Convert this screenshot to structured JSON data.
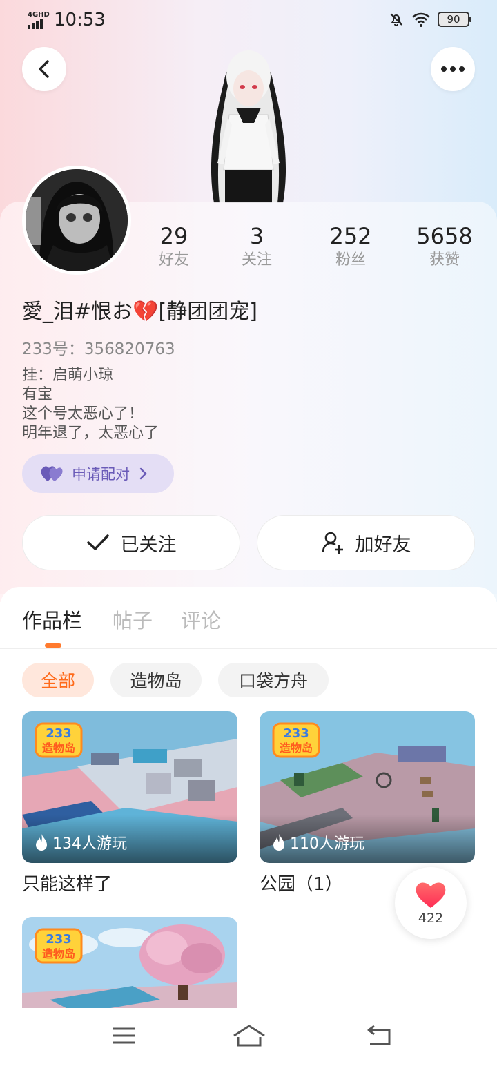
{
  "status_bar": {
    "network": "4GHD",
    "time": "10:53",
    "battery": "90"
  },
  "profile": {
    "stats": [
      {
        "num": "29",
        "label": "好友"
      },
      {
        "num": "3",
        "label": "关注"
      },
      {
        "num": "252",
        "label": "粉丝"
      },
      {
        "num": "5658",
        "label": "获赞"
      }
    ],
    "username": "愛_泪#恨お💔[静团团宠]",
    "user_id": "233号：356820763",
    "bio": [
      "挂：启萌小琼",
      "有宝",
      "这个号太恶心了！",
      "明年退了，太恶心了"
    ],
    "pair_label": "申请配对",
    "follow_label": "已关注",
    "add_friend_label": "加好友"
  },
  "tabs": [
    "作品栏",
    "帖子",
    "评论"
  ],
  "filters": [
    "全部",
    "造物岛",
    "口袋方舟"
  ],
  "works": [
    {
      "title": "只能这样了",
      "plays": "134人游玩",
      "badge": "233 造物岛"
    },
    {
      "title": "公园（1）",
      "plays": "110人游玩",
      "badge": "233 造物岛"
    },
    {
      "title": "",
      "plays": "",
      "badge": "233 造物岛"
    }
  ],
  "like_count": "422",
  "colors": {
    "accent": "#ff6a1a",
    "pair_purple": "#6a5bb8",
    "like_red": "#ff3b4a"
  },
  "icons": [
    "back-arrow-icon",
    "more-dots-icon",
    "heart-icon",
    "chevron-right-icon",
    "check-icon",
    "add-user-icon",
    "flame-icon",
    "menu-icon",
    "home-icon",
    "return-icon"
  ]
}
